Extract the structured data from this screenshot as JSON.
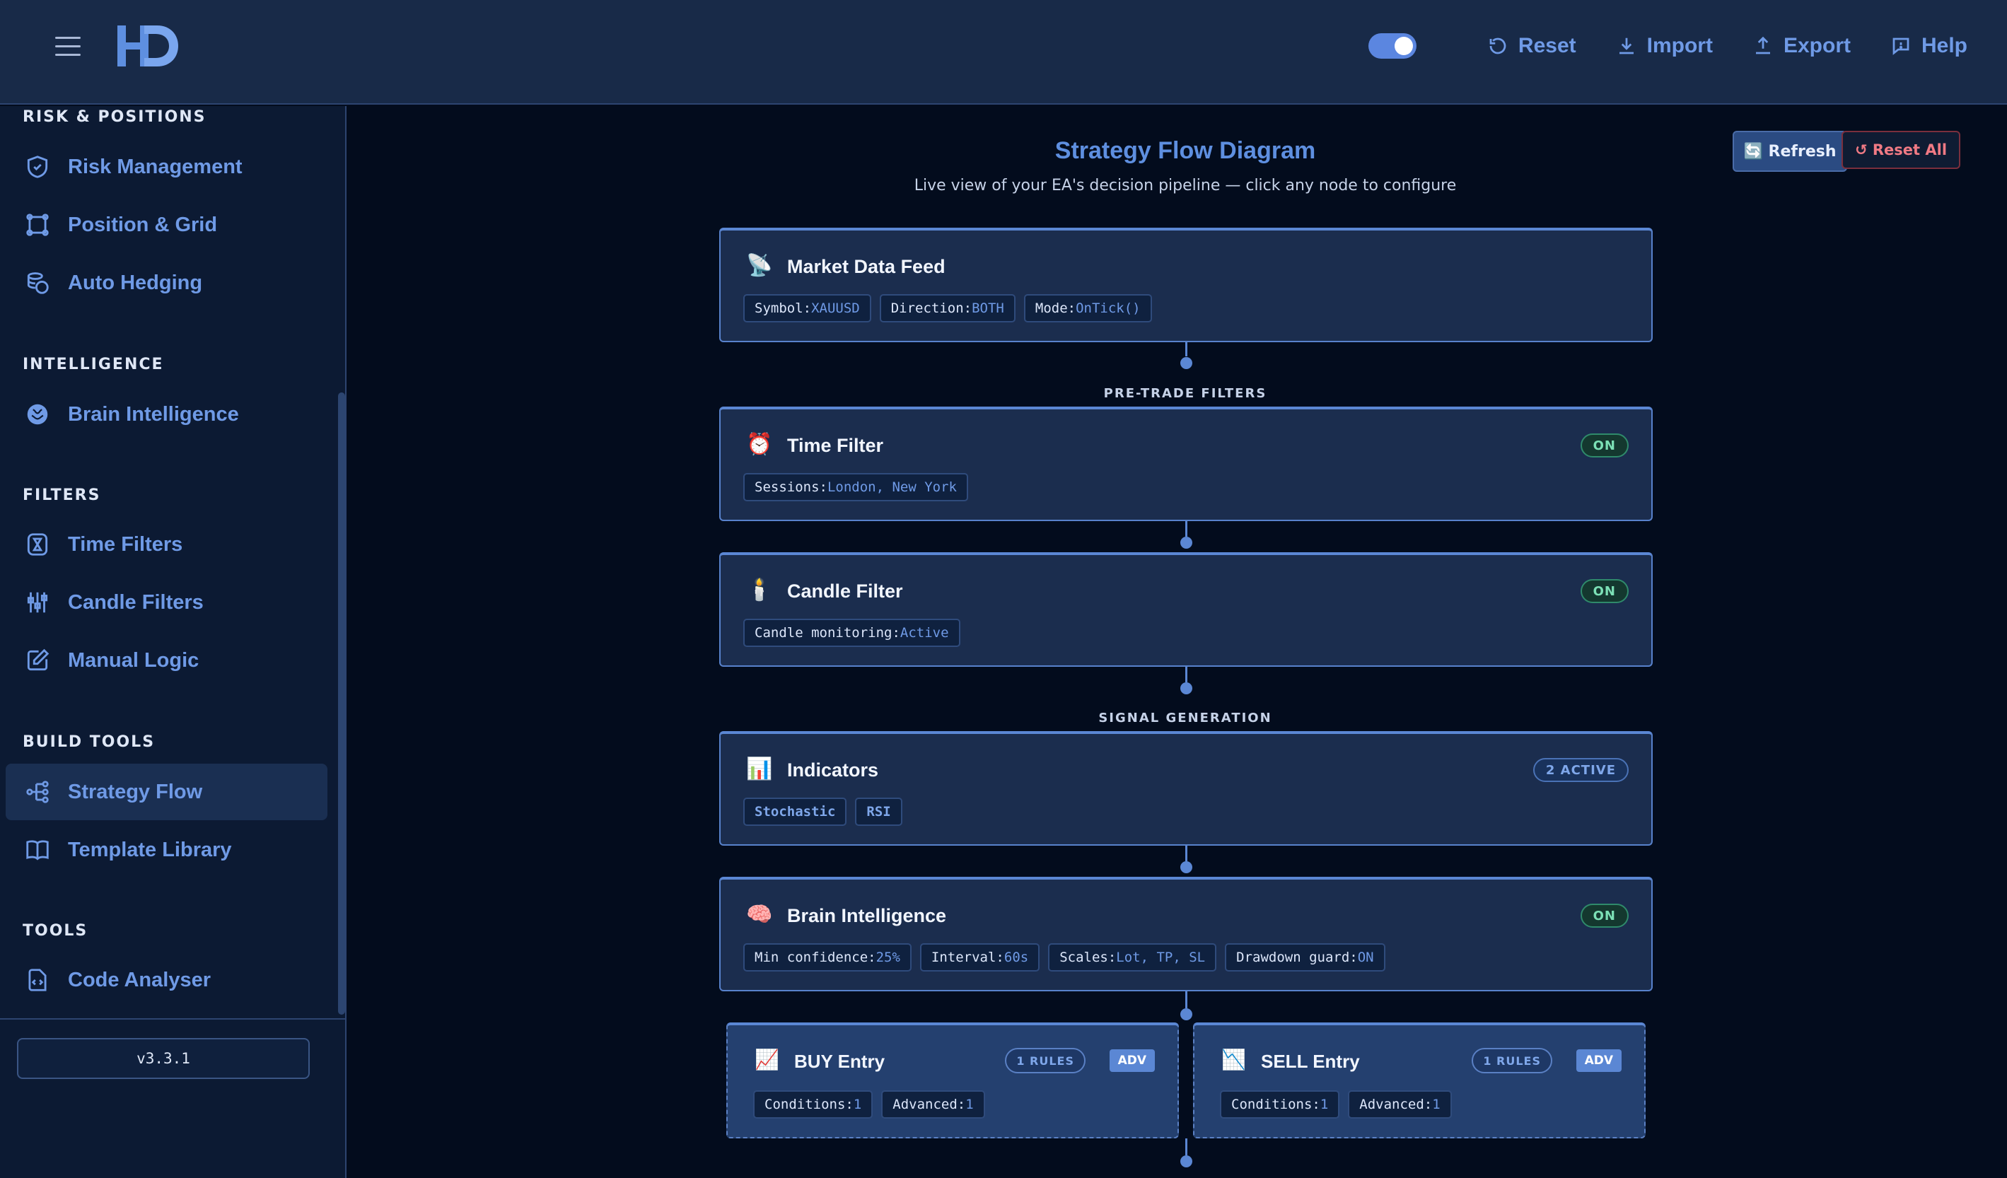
{
  "header": {
    "menu_icon": "hamburger-icon",
    "logo_text": "HD",
    "toggle_on": true,
    "buttons": [
      {
        "label": "Reset",
        "icon": "reset-icon"
      },
      {
        "label": "Import",
        "icon": "import-icon"
      },
      {
        "label": "Export",
        "icon": "export-icon"
      },
      {
        "label": "Help",
        "icon": "help-icon"
      }
    ]
  },
  "sidebar": {
    "sections": {
      "risk": "RISK & POSITIONS",
      "intelligence": "INTELLIGENCE",
      "filters": "FILTERS",
      "build_tools": "BUILD TOOLS",
      "tools": "TOOLS"
    },
    "items": {
      "risk_management": "Risk Management",
      "position_grid": "Position & Grid",
      "auto_hedging": "Auto Hedging",
      "brain_intelligence": "Brain Intelligence",
      "time_filters": "Time Filters",
      "candle_filters": "Candle Filters",
      "manual_logic": "Manual Logic",
      "strategy_flow": "Strategy Flow",
      "template_library": "Template Library",
      "code_analyser": "Code Analyser"
    },
    "active_item": "Strategy Flow",
    "version": "v3.3.1"
  },
  "main": {
    "title": "Strategy Flow Diagram",
    "subtitle": "Live view of your EA's decision pipeline — click any node to configure",
    "refresh_label": "🔄 Refresh",
    "reset_all_label": "↺ Reset All",
    "stages": {
      "pre_trade": "PRE-TRADE FILTERS",
      "signal": "SIGNAL GENERATION"
    },
    "nodes": {
      "market": {
        "icon": "📡",
        "title": "Market Data Feed",
        "symbol_key": "Symbol: ",
        "symbol_val": "XAUUSD",
        "direction_key": "Direction: ",
        "direction_val": "BOTH",
        "mode_key": "Mode: ",
        "mode_val": "OnTick()"
      },
      "time": {
        "icon": "⏰",
        "title": "Time Filter",
        "badge": "ON",
        "sessions_key": "Sessions: ",
        "sessions_val": "London, New York"
      },
      "candle": {
        "icon": "🕯️",
        "title": "Candle Filter",
        "badge": "ON",
        "monitor_key": "Candle monitoring: ",
        "monitor_val": "Active"
      },
      "indicators": {
        "icon": "📊",
        "title": "Indicators",
        "badge": "2 ACTIVE",
        "items": [
          "Stochastic",
          "RSI"
        ]
      },
      "brain": {
        "icon": "🧠",
        "title": "Brain Intelligence",
        "badge": "ON",
        "conf_key": "Min confidence: ",
        "conf_val": "25%",
        "interval_key": "Interval: ",
        "interval_val": "60s",
        "scales_key": "Scales: ",
        "scales_val": "Lot, TP, SL",
        "dd_key": "Drawdown guard: ",
        "dd_val": "ON"
      },
      "buy": {
        "icon": "📈",
        "title": "BUY Entry",
        "rules": "1 RULES",
        "adv": "ADV",
        "cond_key": "Conditions: ",
        "cond_val": "1",
        "adv_key": "Advanced: ",
        "adv_val": "1"
      },
      "sell": {
        "icon": "📉",
        "title": "SELL Entry",
        "rules": "1 RULES",
        "adv": "ADV",
        "cond_key": "Conditions: ",
        "cond_val": "1",
        "adv_key": "Advanced: ",
        "adv_val": "1"
      }
    }
  },
  "colors": {
    "accent": "#5b87d4",
    "link": "#6f9ae6",
    "background": "#030c1d",
    "success": "#7ce0b6",
    "danger": "#f07a84"
  }
}
